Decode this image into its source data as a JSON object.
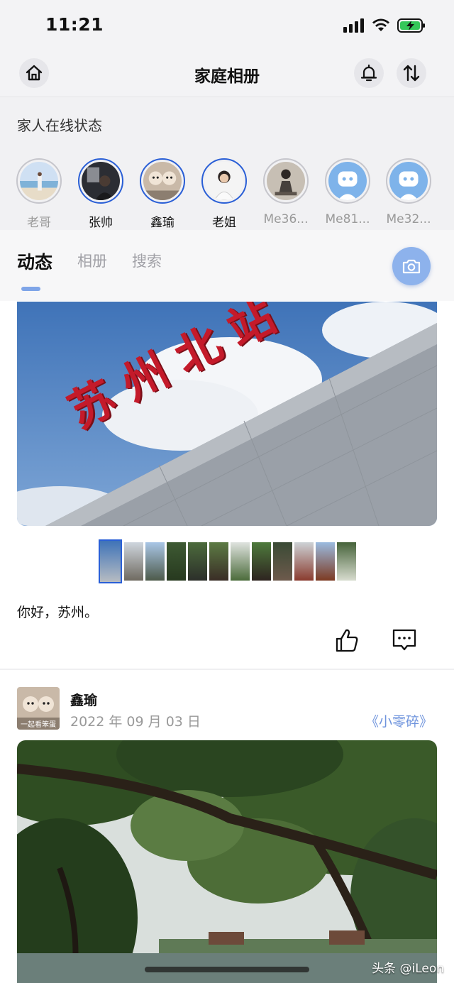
{
  "status_bar": {
    "time": "11:21"
  },
  "header": {
    "title": "家庭相册"
  },
  "online": {
    "title": "家人在线状态",
    "members": [
      {
        "name": "老哥",
        "online": false
      },
      {
        "name": "张帅",
        "online": true
      },
      {
        "name": "鑫瑜",
        "online": true
      },
      {
        "name": "老姐",
        "online": true
      },
      {
        "name": "Me36...",
        "online": false
      },
      {
        "name": "Me81...",
        "online": false
      },
      {
        "name": "Me32...",
        "online": false
      }
    ]
  },
  "tabs": [
    {
      "label": "动态",
      "active": true
    },
    {
      "label": "相册",
      "active": false
    },
    {
      "label": "搜索",
      "active": false
    }
  ],
  "post1": {
    "sign_text": "苏州北站",
    "text": "你好，苏州。",
    "thumbnail_count": 12,
    "selected_thumbnail": 1
  },
  "post2": {
    "author": "鑫瑜",
    "date": "2022 年 09 月 03 日",
    "album": "《小零碎》",
    "avatar_caption": "一起看笨蛋"
  },
  "watermark": "头条 @iLeon",
  "colors": {
    "accent": "#2a5fd6",
    "accent_light": "#8db2ec",
    "link": "#6f94dd",
    "sign_red": "#c41a2a"
  },
  "icons": [
    "home-icon",
    "bell-icon",
    "sort-icon",
    "camera-icon",
    "thumbs-up-icon",
    "comment-icon",
    "signal-icon",
    "wifi-icon",
    "battery-charging-icon"
  ]
}
